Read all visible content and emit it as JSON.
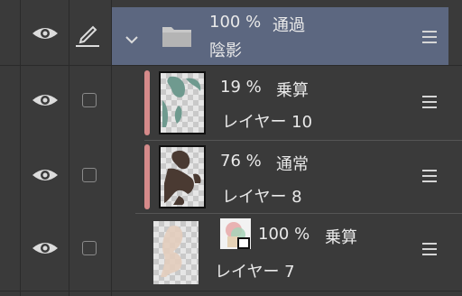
{
  "layers": [
    {
      "percent": "100 %",
      "mode": "通過",
      "name": "陰影"
    },
    {
      "percent": "19 %",
      "mode": "乗算",
      "name": "レイヤー 10"
    },
    {
      "percent": "76 %",
      "mode": "通常",
      "name": "レイヤー 8"
    },
    {
      "percent": "100 %",
      "mode": "乗算",
      "name": "レイヤー 7"
    }
  ],
  "colors": {
    "panel_bg": "#3a3a3a",
    "selected_bg": "#5c6780",
    "mask_accent": "#d58a8a"
  },
  "icons": [
    "eye-icon",
    "pen-icon",
    "chevron-down-icon",
    "folder-icon",
    "checkbox",
    "hamburger-menu-icon"
  ]
}
